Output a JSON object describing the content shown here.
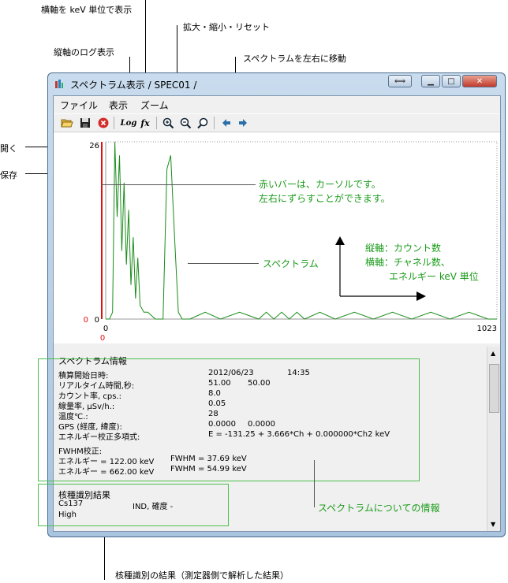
{
  "callouts": {
    "kev_axis": "横軸を keV 単位で表示",
    "zoom": "拡大・縮小・リセット",
    "log": "縦軸のログ表示",
    "move": "スペクトラムを左右に移動",
    "open": "開く",
    "save": "保存",
    "nuclide_result": "核種識別の結果（測定器側で解析した結果）"
  },
  "window": {
    "title": "スペクトラム表示 / SPEC01 /",
    "menu": [
      "ファイル",
      "表示",
      "ズーム"
    ]
  },
  "toolbar": {
    "log_label": "Log",
    "fx_label": "fx"
  },
  "chart_data": {
    "type": "line",
    "xlim": [
      0,
      1023
    ],
    "ylim": [
      0,
      26
    ],
    "x_tick_labels": [
      "0",
      "1023"
    ],
    "y_tick_labels": [
      "26",
      "0"
    ],
    "cursor_value": "0",
    "cursor_x_label": "0",
    "series": [
      {
        "color": "#1a8c1a",
        "x": [
          0,
          10,
          18,
          24,
          30,
          36,
          42,
          48,
          54,
          60,
          66,
          72,
          78,
          84,
          90,
          100,
          110,
          130,
          150,
          160,
          170,
          180,
          190,
          200,
          220,
          260,
          300,
          350,
          400,
          420,
          440,
          460,
          480,
          500,
          520,
          560,
          600,
          650,
          700,
          750,
          800,
          850,
          900,
          950,
          1000,
          1023
        ],
        "y": [
          0,
          0,
          1,
          26,
          15,
          24,
          10,
          20,
          8,
          16,
          5,
          12,
          3,
          9,
          2,
          1,
          1,
          0,
          0,
          22,
          24,
          12,
          1,
          0,
          0,
          1,
          0,
          1,
          0,
          1,
          0,
          1,
          0,
          1,
          0,
          1,
          0,
          1,
          0,
          1,
          0,
          1,
          0,
          1,
          0,
          0
        ]
      }
    ]
  },
  "annotations": {
    "cursor_note_1": "赤いバーは、カーソルです。",
    "cursor_note_2": "左右にずらすことができます。",
    "axis_note_1": "縦軸：カウント数",
    "axis_note_2": "横軸：チャネル数、",
    "axis_note_3": "エネルギー keV 単位",
    "spectrum_note": "スペクトラム",
    "info_note": "スペクトラムについての情報"
  },
  "info": {
    "heading": "スペクトラム情報",
    "rows": [
      {
        "label": "積算開始日時:",
        "value": "2012/06/23",
        "value2": "14:35"
      },
      {
        "label": "リアルタイム時間,秒:",
        "value": "51.00",
        "value2": "50.00"
      },
      {
        "label": "カウント率, cps.:",
        "value": "8.0",
        "value2": ""
      },
      {
        "label": "線量率, μSv/h.:",
        "value": "0.05",
        "value2": ""
      },
      {
        "label": "温度℃.:",
        "value": "28",
        "value2": ""
      },
      {
        "label": "GPS (経度, 緯度):",
        "value": "0.0000",
        "value2": "0.0000"
      },
      {
        "label": "エネルギー校正多項式:",
        "value": "E = -131.25 + 3.666*Ch + 0.000000*Ch2 keV",
        "value2": ""
      }
    ],
    "fwhm_heading": "FWHM校正:",
    "fwhm_rows": [
      {
        "energy": "エネルギー =   122.00 keV",
        "fwhm": "FWHM = 37.69 keV"
      },
      {
        "energy": "エネルギー =   662.00 keV",
        "fwhm": "FWHM = 54.99 keV"
      }
    ],
    "nuclide_heading": "核種識別結果",
    "nuclide_name": "Cs137",
    "nuclide_ind": "IND, 確度 -",
    "nuclide_level": "High"
  }
}
